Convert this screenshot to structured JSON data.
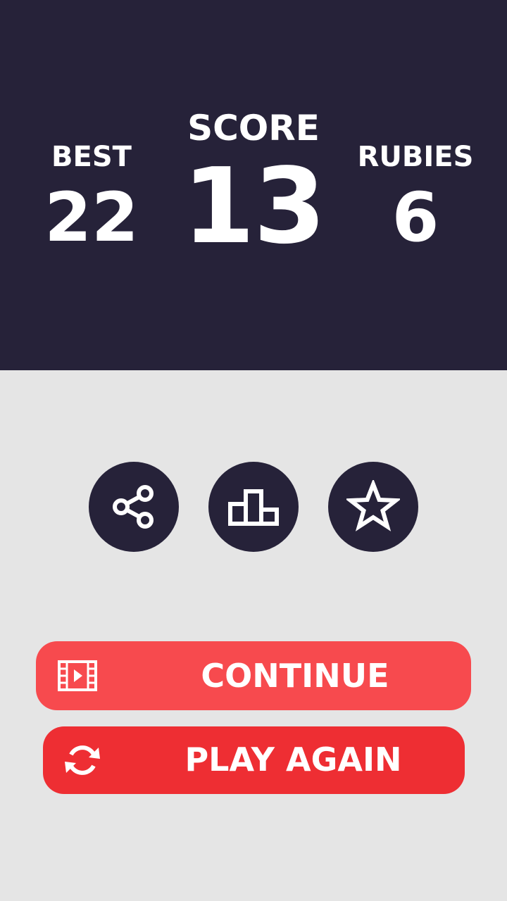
{
  "colors": {
    "panel_background": "#262239",
    "page_background": "#e5e5e5",
    "continue_button": "#f74a4e",
    "play_again_button": "#ee2e33",
    "text": "#ffffff"
  },
  "stats": {
    "best": {
      "label": "BEST",
      "value": "22"
    },
    "score": {
      "label": "SCORE",
      "value": "13"
    },
    "rubies": {
      "label": "RUBIES",
      "value": "6"
    }
  },
  "icon_buttons": [
    {
      "name": "share",
      "icon": "share-icon"
    },
    {
      "name": "leaderboard",
      "icon": "podium-icon"
    },
    {
      "name": "rate",
      "icon": "star-icon"
    }
  ],
  "actions": {
    "continue": {
      "label": "CONTINUE",
      "icon": "video-icon"
    },
    "play_again": {
      "label": "PLAY AGAIN",
      "icon": "refresh-icon"
    }
  }
}
